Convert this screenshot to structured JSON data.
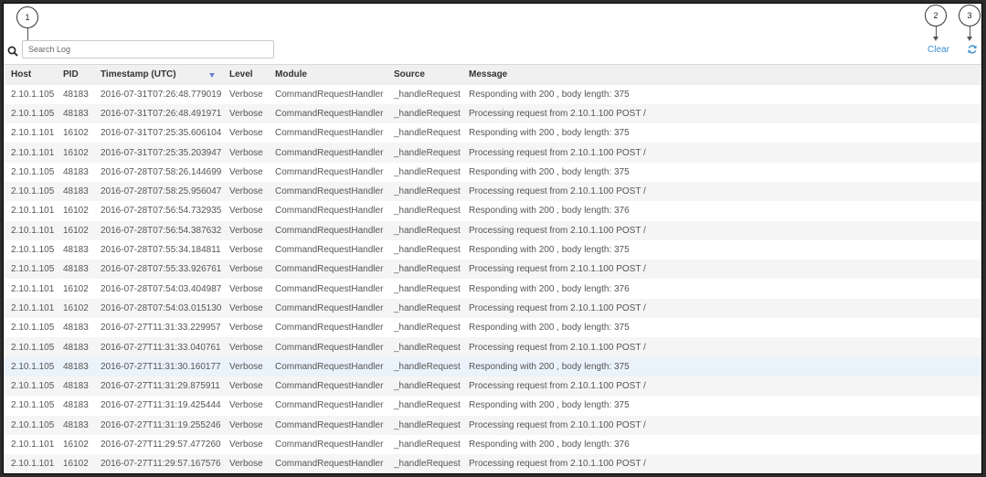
{
  "search": {
    "placeholder": "Search Log",
    "value": ""
  },
  "toolbar": {
    "clear_label": "Clear"
  },
  "callouts": {
    "c1": "1",
    "c2": "2",
    "c3": "3"
  },
  "icons": {
    "search": "search-icon",
    "refresh": "refresh-icon",
    "sort": "sort-descending-icon"
  },
  "colors": {
    "accent": "#3a8fd0",
    "sort_indicator": "#6a7fd4",
    "header_bg": "#f0f0f0",
    "row_alt": "#f5f5f5",
    "row_selected": "#eaf2fb"
  },
  "table": {
    "columns": [
      "Host",
      "PID",
      "Timestamp (UTC)",
      "Level",
      "Module",
      "Source",
      "Message"
    ],
    "sorted_column": "Timestamp (UTC)",
    "selected_row": 14,
    "rows": [
      [
        "2.10.1.105",
        "48183",
        "2016-07-31T07:26:48.779019",
        "Verbose",
        "CommandRequestHandler",
        "_handleRequest",
        "Responding with 200 , body length: 375"
      ],
      [
        "2.10.1.105",
        "48183",
        "2016-07-31T07:26:48.491971",
        "Verbose",
        "CommandRequestHandler",
        "_handleRequest",
        "Processing request from 2.10.1.100 POST /"
      ],
      [
        "2.10.1.101",
        "16102",
        "2016-07-31T07:25:35.606104",
        "Verbose",
        "CommandRequestHandler",
        "_handleRequest",
        "Responding with 200 , body length: 375"
      ],
      [
        "2.10.1.101",
        "16102",
        "2016-07-31T07:25:35.203947",
        "Verbose",
        "CommandRequestHandler",
        "_handleRequest",
        "Processing request from 2.10.1.100 POST /"
      ],
      [
        "2.10.1.105",
        "48183",
        "2016-07-28T07:58:26.144699",
        "Verbose",
        "CommandRequestHandler",
        "_handleRequest",
        "Responding with 200 , body length: 375"
      ],
      [
        "2.10.1.105",
        "48183",
        "2016-07-28T07:58:25.956047",
        "Verbose",
        "CommandRequestHandler",
        "_handleRequest",
        "Processing request from 2.10.1.100 POST /"
      ],
      [
        "2.10.1.101",
        "16102",
        "2016-07-28T07:56:54.732935",
        "Verbose",
        "CommandRequestHandler",
        "_handleRequest",
        "Responding with 200 , body length: 376"
      ],
      [
        "2.10.1.101",
        "16102",
        "2016-07-28T07:56:54.387632",
        "Verbose",
        "CommandRequestHandler",
        "_handleRequest",
        "Processing request from 2.10.1.100 POST /"
      ],
      [
        "2.10.1.105",
        "48183",
        "2016-07-28T07:55:34.184811",
        "Verbose",
        "CommandRequestHandler",
        "_handleRequest",
        "Responding with 200 , body length: 375"
      ],
      [
        "2.10.1.105",
        "48183",
        "2016-07-28T07:55:33.926761",
        "Verbose",
        "CommandRequestHandler",
        "_handleRequest",
        "Processing request from 2.10.1.100 POST /"
      ],
      [
        "2.10.1.101",
        "16102",
        "2016-07-28T07:54:03.404987",
        "Verbose",
        "CommandRequestHandler",
        "_handleRequest",
        "Responding with 200 , body length: 376"
      ],
      [
        "2.10.1.101",
        "16102",
        "2016-07-28T07:54:03.015130",
        "Verbose",
        "CommandRequestHandler",
        "_handleRequest",
        "Processing request from 2.10.1.100 POST /"
      ],
      [
        "2.10.1.105",
        "48183",
        "2016-07-27T11:31:33.229957",
        "Verbose",
        "CommandRequestHandler",
        "_handleRequest",
        "Responding with 200 , body length: 375"
      ],
      [
        "2.10.1.105",
        "48183",
        "2016-07-27T11:31:33.040761",
        "Verbose",
        "CommandRequestHandler",
        "_handleRequest",
        "Processing request from 2.10.1.100 POST /"
      ],
      [
        "2.10.1.105",
        "48183",
        "2016-07-27T11:31:30.160177",
        "Verbose",
        "CommandRequestHandler",
        "_handleRequest",
        "Responding with 200 , body length: 375"
      ],
      [
        "2.10.1.105",
        "48183",
        "2016-07-27T11:31:29.875911",
        "Verbose",
        "CommandRequestHandler",
        "_handleRequest",
        "Processing request from 2.10.1.100 POST /"
      ],
      [
        "2.10.1.105",
        "48183",
        "2016-07-27T11:31:19.425444",
        "Verbose",
        "CommandRequestHandler",
        "_handleRequest",
        "Responding with 200 , body length: 375"
      ],
      [
        "2.10.1.105",
        "48183",
        "2016-07-27T11:31:19.255246",
        "Verbose",
        "CommandRequestHandler",
        "_handleRequest",
        "Processing request from 2.10.1.100 POST /"
      ],
      [
        "2.10.1.101",
        "16102",
        "2016-07-27T11:29:57.477260",
        "Verbose",
        "CommandRequestHandler",
        "_handleRequest",
        "Responding with 200 , body length: 376"
      ],
      [
        "2.10.1.101",
        "16102",
        "2016-07-27T11:29:57.167576",
        "Verbose",
        "CommandRequestHandler",
        "_handleRequest",
        "Processing request from 2.10.1.100 POST /"
      ]
    ]
  }
}
